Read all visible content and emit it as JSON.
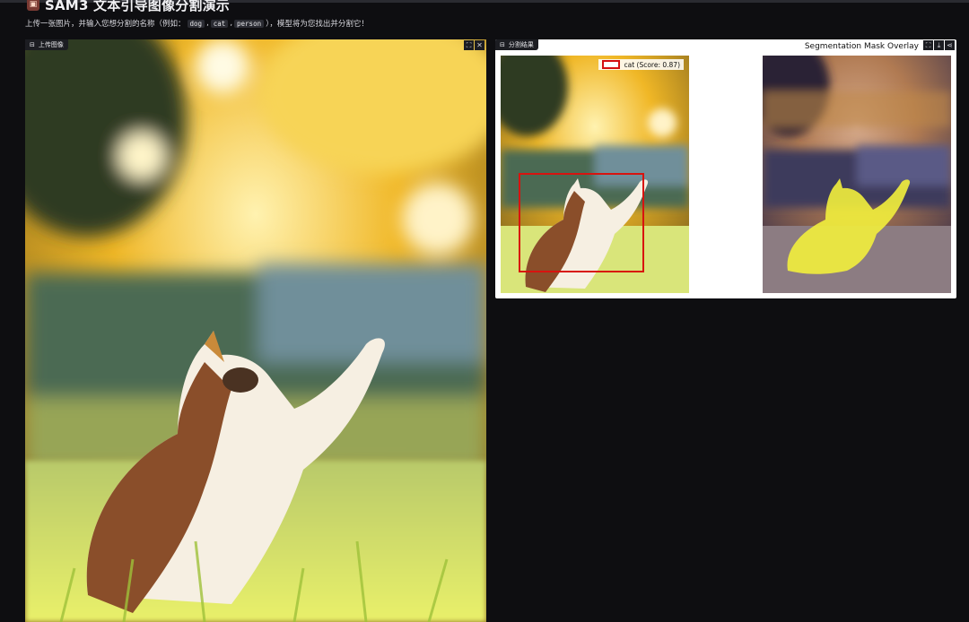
{
  "header": {
    "title": "SAM3 文本引导图像分割演示",
    "logo_icon": "app-logo-icon",
    "subtitle_prefix": "上传一张图片，并输入您想分割的名称（例如：",
    "examples": [
      "dog",
      "cat",
      "person"
    ],
    "separator": ",",
    "subtitle_suffix": "），模型将为您找出并分割它！"
  },
  "upload": {
    "label": "上传图像",
    "icon": "image-icon",
    "fullscreen_icon": "fullscreen-icon",
    "close_icon": "close-icon"
  },
  "result": {
    "label": "分割结果",
    "icon": "image-icon",
    "overlay_title": "Segmentation Mask Overlay",
    "legend_text": "cat (Score: 0.87)",
    "fullscreen_icon": "fullscreen-icon",
    "download_icon": "download-icon",
    "share_icon": "share-icon"
  },
  "colors": {
    "background": "#0e0e11",
    "bbox": "#d8130f",
    "mask": "#f2ef3c"
  }
}
